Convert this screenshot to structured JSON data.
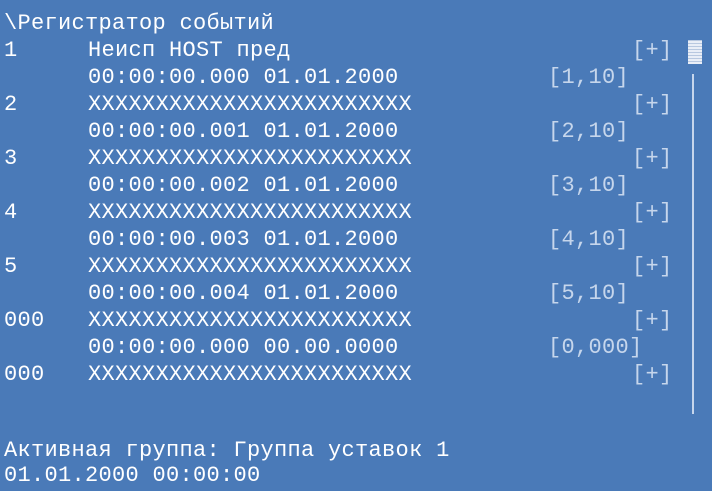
{
  "title": "\\Регистратор событий",
  "events": [
    {
      "index": "1",
      "text": "Неисп HOST пред",
      "flag": "[+]",
      "time": "00:00:00.000 01.01.2000",
      "code": "[1,10]"
    },
    {
      "index": "2",
      "text": "XXXXXXXXXXXXXXXXXXXXXXXX",
      "flag": "[+]",
      "time": "00:00:00.001 01.01.2000",
      "code": "[2,10]"
    },
    {
      "index": "3",
      "text": "XXXXXXXXXXXXXXXXXXXXXXXX",
      "flag": "[+]",
      "time": "00:00:00.002 01.01.2000",
      "code": "[3,10]"
    },
    {
      "index": "4",
      "text": "XXXXXXXXXXXXXXXXXXXXXXXX",
      "flag": "[+]",
      "time": "00:00:00.003 01.01.2000",
      "code": "[4,10]"
    },
    {
      "index": "5",
      "text": "XXXXXXXXXXXXXXXXXXXXXXXX",
      "flag": "[+]",
      "time": "00:00:00.004 01.01.2000",
      "code": "[5,10]"
    },
    {
      "index": "000",
      "text": "XXXXXXXXXXXXXXXXXXXXXXXX",
      "flag": "[+]",
      "time": "00:00:00.000 00.00.0000",
      "code": "[0,000]"
    },
    {
      "index": "000",
      "text": "XXXXXXXXXXXXXXXXXXXXXXXX",
      "flag": "[+]",
      "time": "",
      "code": ""
    }
  ],
  "status": {
    "active_group": "Активная группа: Группа уставок 1",
    "datetime": "01.01.2000 00:00:00"
  },
  "colors": {
    "background": "#4a7ab8",
    "text": "#ffffff",
    "dim_text": "#c6d6ec"
  }
}
